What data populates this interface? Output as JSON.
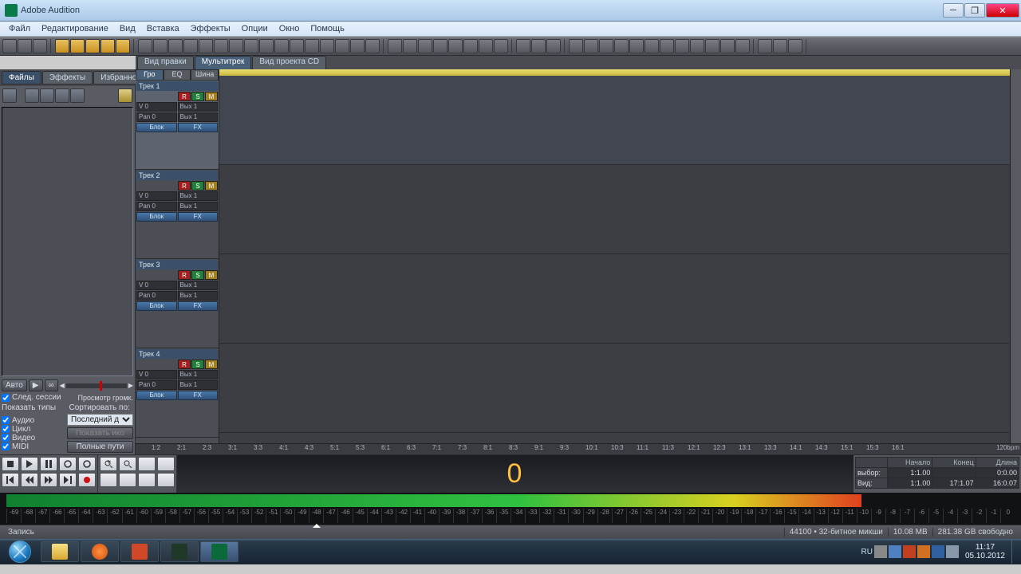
{
  "app": {
    "title": "Adobe Audition"
  },
  "menu": [
    "Файл",
    "Редактирование",
    "Вид",
    "Вставка",
    "Эффекты",
    "Опции",
    "Окно",
    "Помощь"
  ],
  "view_tabs": [
    {
      "label": "Вид правки",
      "active": false
    },
    {
      "label": "Мультитрек",
      "active": true
    },
    {
      "label": "Вид проекта CD",
      "active": false
    }
  ],
  "file_tabs": [
    {
      "label": "Файлы",
      "active": true
    },
    {
      "label": "Эффекты",
      "active": false
    },
    {
      "label": "Избранное",
      "active": false
    }
  ],
  "file_bottom": {
    "auto": "Авто",
    "follow_session": "След. сессии",
    "preview_vol": "Просмотр громк.",
    "show_types": "Показать типы",
    "sort_by": "Сортировать по:",
    "sort_val": "Последний д",
    "t_audio": "Аудио",
    "t_loop": "Цикл",
    "t_video": "Видео",
    "t_midi": "MIDI",
    "show_icons": "Показать ико",
    "full_paths": "Полные пути"
  },
  "track_subtabs": [
    "Гро",
    "EQ",
    "Шина"
  ],
  "tracks": [
    {
      "label": "Трек 1",
      "vol": "V 0",
      "pan": "Pan 0",
      "bus": "Вых 1",
      "sel": true
    },
    {
      "label": "Трек 2",
      "vol": "V 0",
      "pan": "Pan 0",
      "bus": "Вых 1",
      "sel": false
    },
    {
      "label": "Трек 3",
      "vol": "V 0",
      "pan": "Pan 0",
      "bus": "Вых 1",
      "sel": false
    },
    {
      "label": "Трек 4",
      "vol": "V 0",
      "pan": "Pan 0",
      "bus": "Вых 1",
      "sel": false
    }
  ],
  "track_btns": {
    "block": "Блок",
    "fx": "FX"
  },
  "ruler": [
    "1:2",
    "2:1",
    "2:3",
    "3:1",
    "3:3",
    "4:1",
    "4:3",
    "5:1",
    "5:3",
    "6:1",
    "6:3",
    "7:1",
    "7:3",
    "8:1",
    "8:3",
    "9:1",
    "9:3",
    "10:1",
    "10:3",
    "11:1",
    "11:3",
    "12:1",
    "12:3",
    "13:1",
    "13:3",
    "14:1",
    "14:3",
    "15:1",
    "15:3",
    "16:1"
  ],
  "ruler_tempo": "120bpm",
  "time_display": "0",
  "selection": {
    "hdr_begin": "Начало",
    "hdr_end": "Конец",
    "hdr_len": "Длина",
    "row_sel": "выбор:",
    "row_view": "Вид:",
    "sel_begin": "1:1.00",
    "sel_end": "",
    "sel_len": "0:0.00",
    "view_begin": "1:1.00",
    "view_end": "17:1.07",
    "view_len": "16:0.07"
  },
  "level_ticks": [
    "-69",
    "-68",
    "-67",
    "-66",
    "-65",
    "-64",
    "-63",
    "-62",
    "-61",
    "-60",
    "-59",
    "-58",
    "-57",
    "-56",
    "-55",
    "-54",
    "-53",
    "-52",
    "-51",
    "-50",
    "-49",
    "-48",
    "-47",
    "-46",
    "-45",
    "-44",
    "-43",
    "-42",
    "-41",
    "-40",
    "-39",
    "-38",
    "-37",
    "-36",
    "-35",
    "-34",
    "-33",
    "-32",
    "-31",
    "-30",
    "-29",
    "-28",
    "-27",
    "-26",
    "-25",
    "-24",
    "-23",
    "-22",
    "-21",
    "-20",
    "-19",
    "-18",
    "-17",
    "-16",
    "-15",
    "-14",
    "-13",
    "-12",
    "-11",
    "-10",
    "-9",
    "-8",
    "-7",
    "-6",
    "-5",
    "-4",
    "-3",
    "-2",
    "-1",
    "0"
  ],
  "status": {
    "left": "Запись",
    "rate": "44100 • 32-битное микши",
    "mem": "10.08 MB",
    "free": "281.38 GB свободно"
  },
  "taskbar": {
    "lang": "RU",
    "time": "11:17",
    "date": "05.10.2012"
  }
}
